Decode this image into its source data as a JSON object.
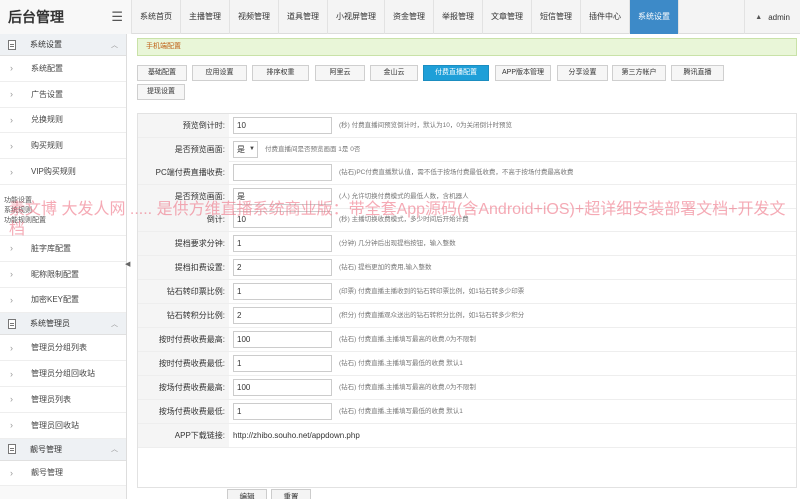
{
  "app": {
    "title": "后台管理",
    "user": "admin"
  },
  "topnav": [
    {
      "label": "系统首页"
    },
    {
      "label": "主播管理"
    },
    {
      "label": "视频管理"
    },
    {
      "label": "道具管理"
    },
    {
      "label": "小视屏管理"
    },
    {
      "label": "资金管理"
    },
    {
      "label": "举报管理"
    },
    {
      "label": "文章管理"
    },
    {
      "label": "短信管理"
    },
    {
      "label": "插件中心"
    },
    {
      "label": "系统设置",
      "active": true
    }
  ],
  "sidebar": {
    "group1": "系统设置",
    "items1": [
      "系统配置",
      "广告设置",
      "兑换规则",
      "购买规则",
      "VIP购买规则"
    ],
    "hidden1": [
      "功能设置",
      "系统规则",
      "功能规则配置"
    ],
    "items1b": [
      "脏字库配置",
      "昵称限制配置",
      "加密KEY配置"
    ],
    "group2": "系统管理员",
    "items2": [
      "管理员分组列表",
      "管理员分组回收站",
      "管理员列表",
      "管理员回收站"
    ],
    "group3": "靓号管理",
    "items3": [
      "靓号管理"
    ]
  },
  "notice": "手机端配置",
  "tabs": [
    {
      "label": "基础配置"
    },
    {
      "label": "应用设置"
    },
    {
      "label": "排序权重"
    },
    {
      "label": "阿里云"
    },
    {
      "label": "金山云"
    },
    {
      "label": "付费直播配置",
      "active": true
    },
    {
      "label": "APP版本管理"
    },
    {
      "label": "分享设置"
    },
    {
      "label": "第三方帐户"
    },
    {
      "label": "腾讯直播"
    },
    {
      "label": "提现设置"
    }
  ],
  "form": [
    {
      "label": "预览倒计时:",
      "value": "10",
      "hint": "(秒) 付费直播间预览倒计时，默认为10，0为关闭倒计时预览"
    },
    {
      "label": "是否预览画面:",
      "select": "是",
      "hint": "付费直播间是否预览画面 1是 0否"
    },
    {
      "label": "PC端付费直播收费:",
      "value": "",
      "hint": "(钻石)PC付费直播默认值，需不低于按场付费最低收费，不高于按场付费最高收费"
    },
    {
      "label": "是否预览画面:",
      "value": "是",
      "hint": "(人) 允许切换付费模式的最低人数，含机器人"
    },
    {
      "label": "倒计:",
      "value": "10",
      "hint": "(秒) 主播切换收费模式，多少时间后开始计费"
    },
    {
      "label": "提档要求分钟:",
      "value": "1",
      "hint": "(分钟) 几分钟后出现提档按钮，输入整数"
    },
    {
      "label": "提档扣费设置:",
      "value": "2",
      "hint": "(钻石) 提档更加的费用,输入整数"
    },
    {
      "label": "钻石转印票比例:",
      "value": "1",
      "hint": "(印票) 付费直播主播收到的钻石转印票比例，如1钻石转多少印票"
    },
    {
      "label": "钻石转积分比例:",
      "value": "2",
      "hint": "(积分) 付费直播观众送出的钻石转积分比例，如1钻石转多少积分"
    },
    {
      "label": "按时付费收费最高:",
      "value": "100",
      "hint": "(钻石) 付费直播,主播填写最高的收费,0为不限制"
    },
    {
      "label": "按时付费收费最低:",
      "value": "1",
      "hint": "(钻石) 付费直播,主播填写最低的收费 默认1"
    },
    {
      "label": "按场付费收费最高:",
      "value": "100",
      "hint": "(钻石) 付费直播,主播填写最高的收费,0为不限制"
    },
    {
      "label": "按场付费收费最低:",
      "value": "1",
      "hint": "(钻石) 付费直播,主播填写最低的收费 默认1"
    },
    {
      "label": "APP下载链接:",
      "text": "http://zhibo.souho.net/appdown.php"
    }
  ],
  "buttons": {
    "edit": "编辑",
    "reset": "重置"
  },
  "watermark": "素文博 大发人网 ..... 是供方维直播系统商业版：带全套App源码(含Android+iOS)+超详细安装部署文档+开发文档"
}
